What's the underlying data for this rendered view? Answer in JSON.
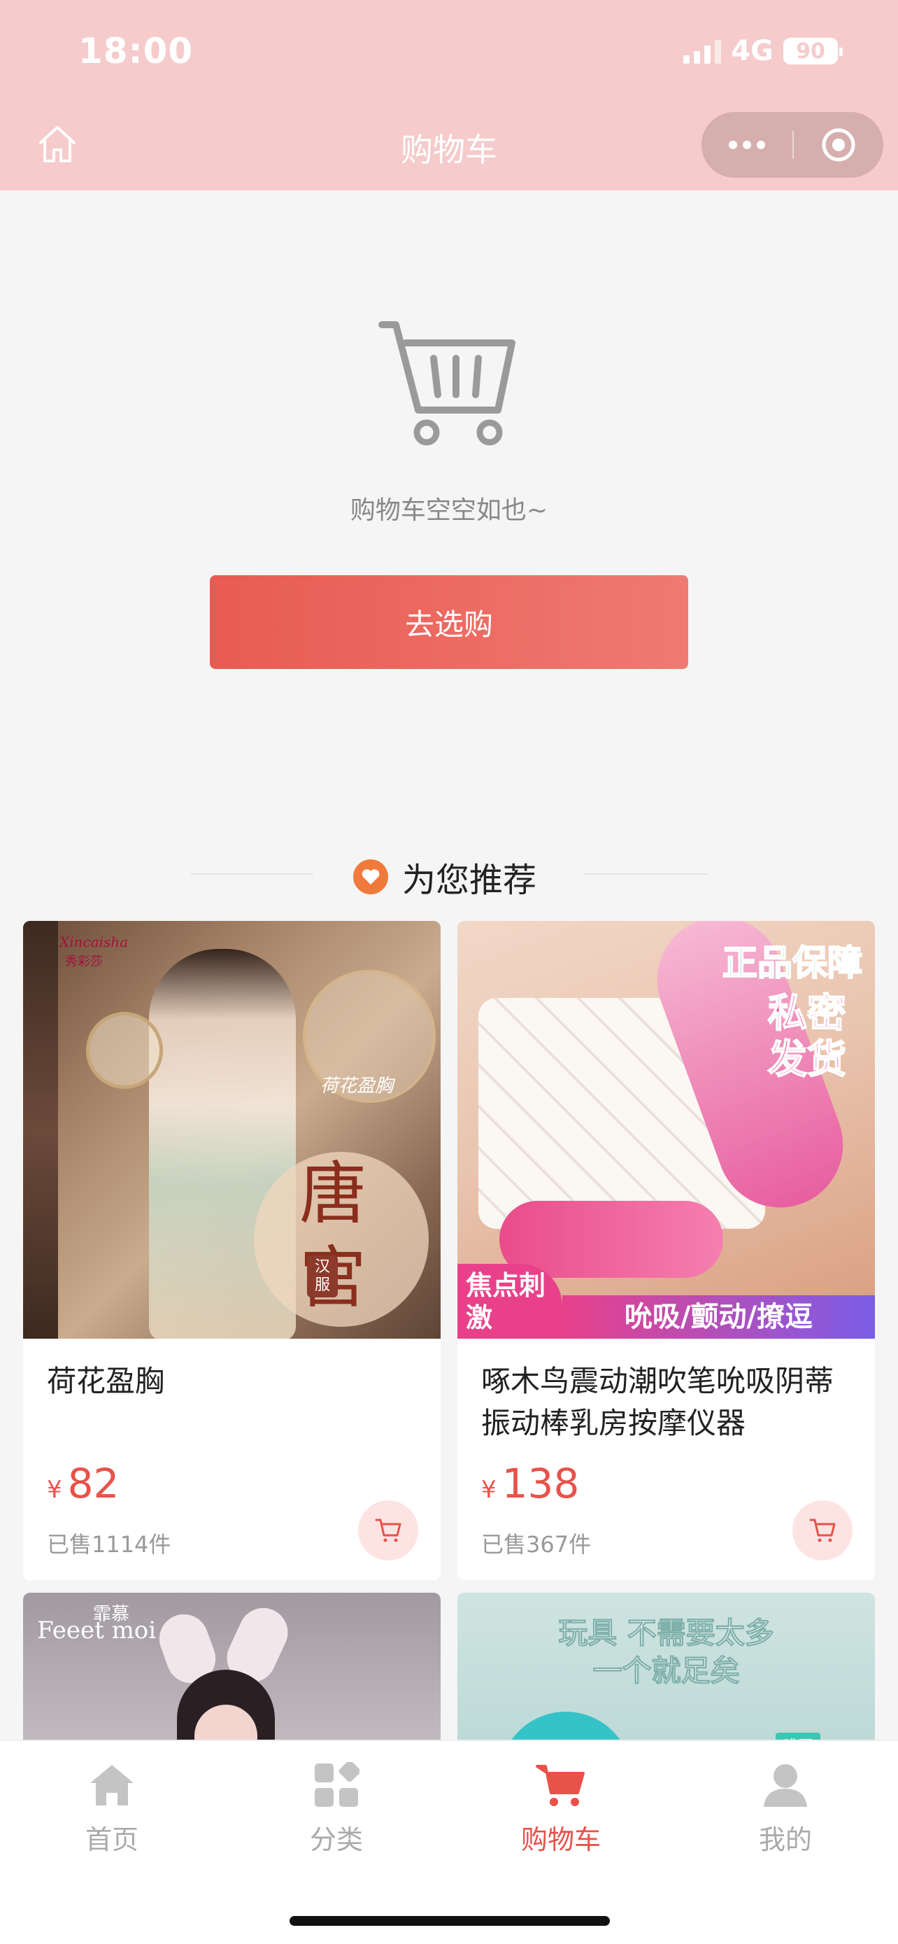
{
  "status_bar": {
    "time": "18:00",
    "network": "4G",
    "battery": "90"
  },
  "nav": {
    "title": "购物车"
  },
  "empty_cart": {
    "message": "购物车空空如也~",
    "button": "去选购"
  },
  "recommend": {
    "title": "为您推荐",
    "products": [
      {
        "name": "荷花盈胸",
        "currency": "¥",
        "price": "82",
        "sold": "已售1114件",
        "image_texts": [
          "Xincaisha",
          "秀彩莎",
          "荷花盈胸",
          "唐宫",
          "汉服"
        ]
      },
      {
        "name": "啄木鸟震动潮吹笔吮吸阴蒂振动棒乳房按摩仪器",
        "currency": "¥",
        "price": "138",
        "sold": "已售367件",
        "image_texts": [
          "正品保障",
          "私密发货",
          "焦点刺激",
          "吮吸/颤动/撩逗"
        ]
      },
      {
        "image_texts": [
          "Feeet moi",
          "霏慕"
        ]
      },
      {
        "image_texts": [
          "玩具 不需要太多",
          "一个就足矣",
          "跳蛋"
        ]
      }
    ]
  },
  "tabbar": [
    {
      "label": "首页",
      "icon": "home-icon",
      "active": false
    },
    {
      "label": "分类",
      "icon": "category-icon",
      "active": false
    },
    {
      "label": "购物车",
      "icon": "cart-icon",
      "active": true
    },
    {
      "label": "我的",
      "icon": "profile-icon",
      "active": false
    }
  ],
  "colors": {
    "header": "#f5cbcb",
    "accent": "#e8524a",
    "background": "#f5f5f5"
  }
}
